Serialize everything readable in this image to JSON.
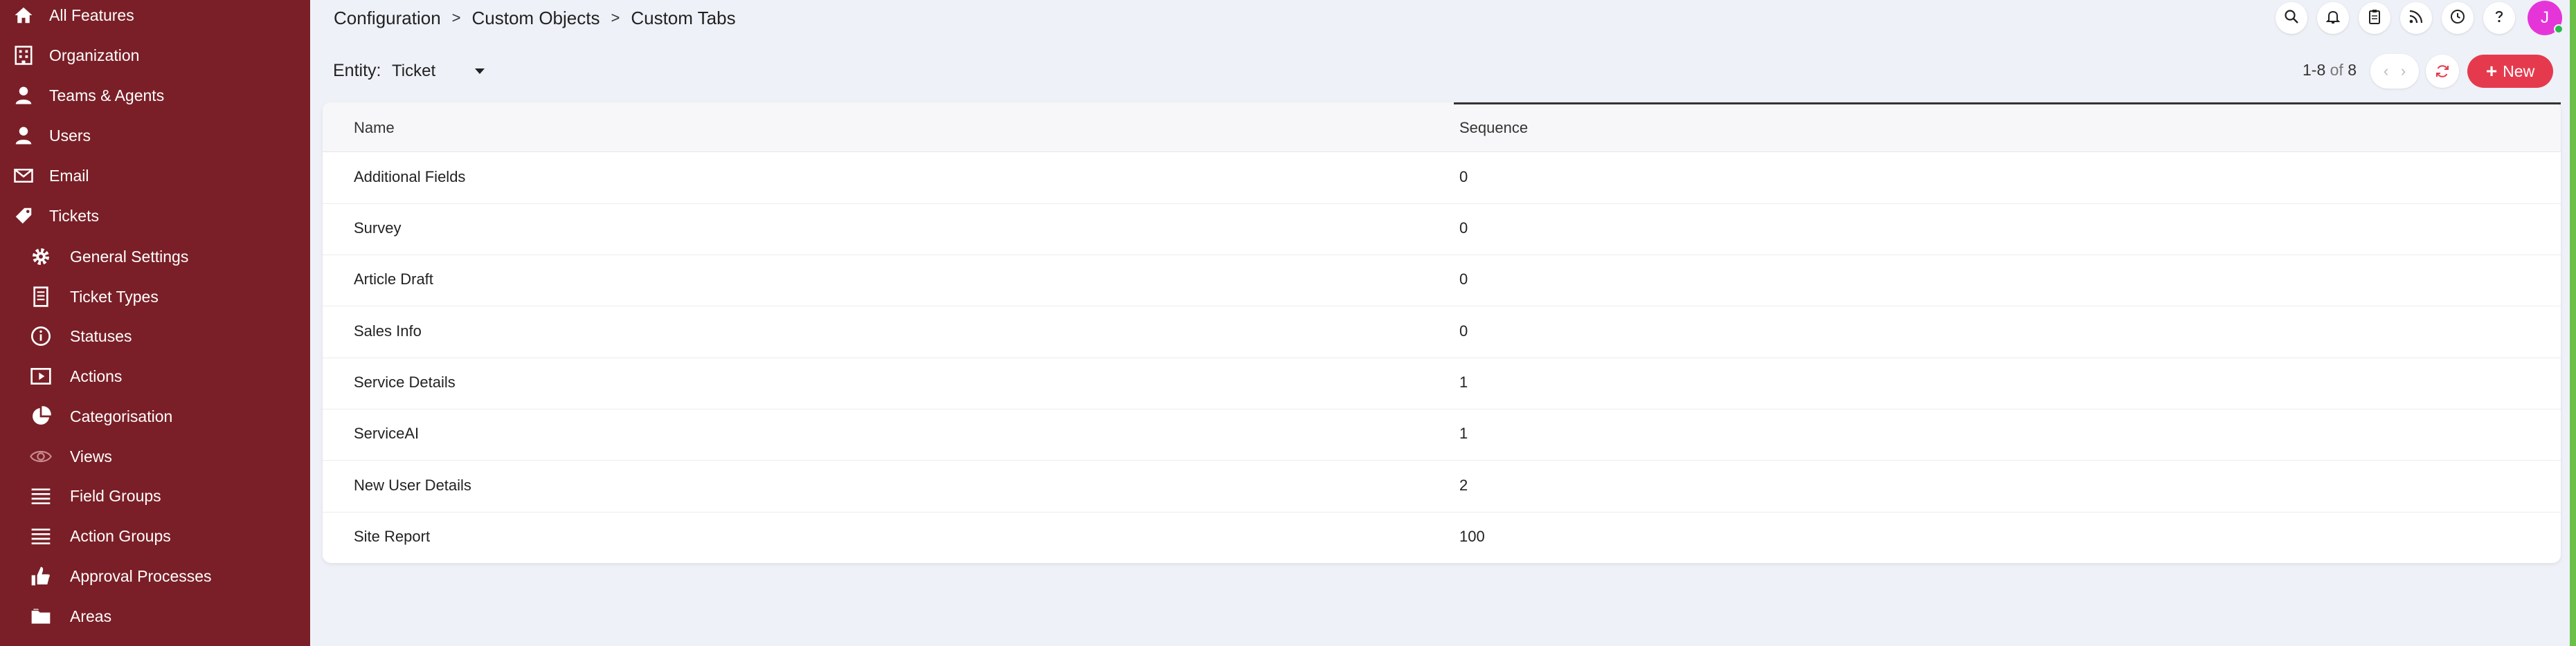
{
  "sidebar": {
    "items": [
      {
        "label": "All Features",
        "icon": "home-icon"
      },
      {
        "label": "Organization",
        "icon": "grid-icon"
      },
      {
        "label": "Teams & Agents",
        "icon": "person-icon"
      },
      {
        "label": "Users",
        "icon": "person-icon"
      },
      {
        "label": "Email",
        "icon": "envelope-icon"
      },
      {
        "label": "Tickets",
        "icon": "tag-icon"
      }
    ],
    "sub_items": [
      {
        "label": "General Settings",
        "icon": "gear-icon"
      },
      {
        "label": "Ticket Types",
        "icon": "document-icon"
      },
      {
        "label": "Statuses",
        "icon": "info-icon"
      },
      {
        "label": "Actions",
        "icon": "play-icon"
      },
      {
        "label": "Categorisation",
        "icon": "pie-icon"
      },
      {
        "label": "Views",
        "icon": "eye-icon"
      },
      {
        "label": "Field Groups",
        "icon": "list-icon"
      },
      {
        "label": "Action Groups",
        "icon": "list-icon"
      },
      {
        "label": "Approval Processes",
        "icon": "thumbs-up-icon"
      },
      {
        "label": "Areas",
        "icon": "folder-icon"
      }
    ]
  },
  "breadcrumb": {
    "items": [
      "Configuration",
      "Custom Objects",
      "Custom Tabs"
    ],
    "separator": ">"
  },
  "header": {
    "avatar_initial": "J",
    "icons": [
      "search-icon",
      "bell-icon",
      "clipboard-icon",
      "rss-icon",
      "clock-icon",
      "help-icon"
    ]
  },
  "toolbar": {
    "entity_label": "Entity:",
    "entity_value": "Ticket",
    "pager_range": "1-8",
    "pager_of": "of",
    "pager_total": "8",
    "prev_glyph": "‹",
    "next_glyph": "›",
    "new_label": "New"
  },
  "table": {
    "columns": [
      "Name",
      "Sequence"
    ],
    "rows": [
      {
        "name": "Additional Fields",
        "sequence": "0"
      },
      {
        "name": "Survey",
        "sequence": "0"
      },
      {
        "name": "Article Draft",
        "sequence": "0"
      },
      {
        "name": "Sales Info",
        "sequence": "0"
      },
      {
        "name": "Service Details",
        "sequence": "1"
      },
      {
        "name": "ServiceAI",
        "sequence": "1"
      },
      {
        "name": "New User Details",
        "sequence": "2"
      },
      {
        "name": "Site Report",
        "sequence": "100"
      }
    ]
  },
  "colors": {
    "sidebar_bg": "#7a1f27",
    "accent": "#e53a4e",
    "avatar": "#e535d8",
    "page_bg": "#eff1f8"
  }
}
